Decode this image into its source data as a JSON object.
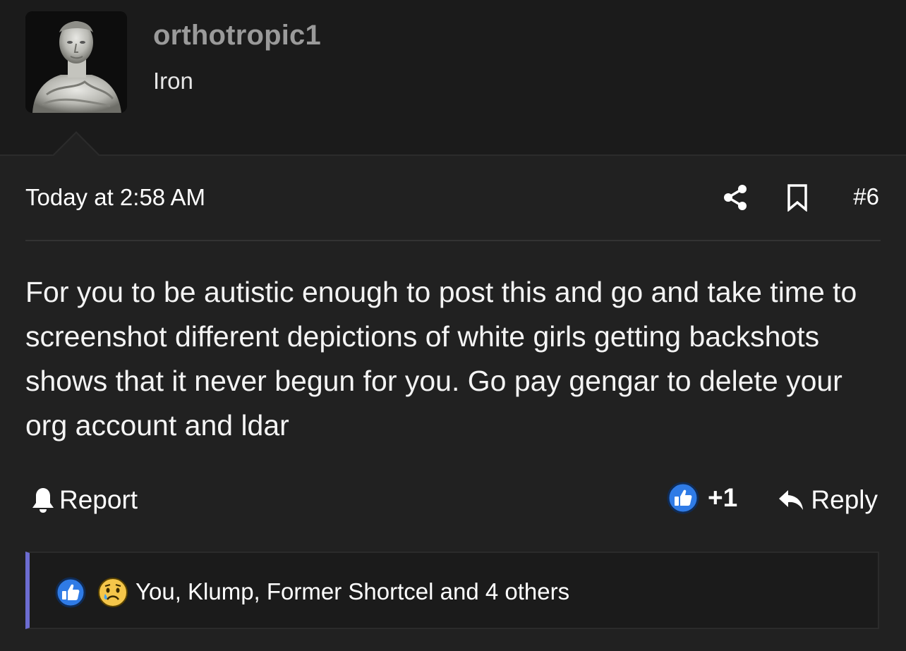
{
  "user": {
    "username": "orthotropic1",
    "title": "Iron",
    "avatar_icon": "marble-bust-avatar"
  },
  "post": {
    "timestamp": "Today at 2:58 AM",
    "number": "#6",
    "share_icon": "share-icon",
    "bookmark_icon": "bookmark-icon",
    "body": "For you to be autistic enough to post this and go and take time to screenshot different depictions of white girls getting backshots shows that it never begun for you. Go pay gengar to delete your org account and ldar"
  },
  "actions": {
    "report_label": "Report",
    "like_count": "+1",
    "reply_label": "Reply"
  },
  "reactions": {
    "text": "You, Klump, Former Shortcel and 4 others",
    "icons": [
      "like-icon",
      "sad-cry-icon"
    ]
  },
  "colors": {
    "background": "#212121",
    "header_background": "#1b1b1b",
    "like_blue": "#2f7be6",
    "reactions_accent": "#6c6cd1",
    "username_gray": "#9a9a9a"
  }
}
